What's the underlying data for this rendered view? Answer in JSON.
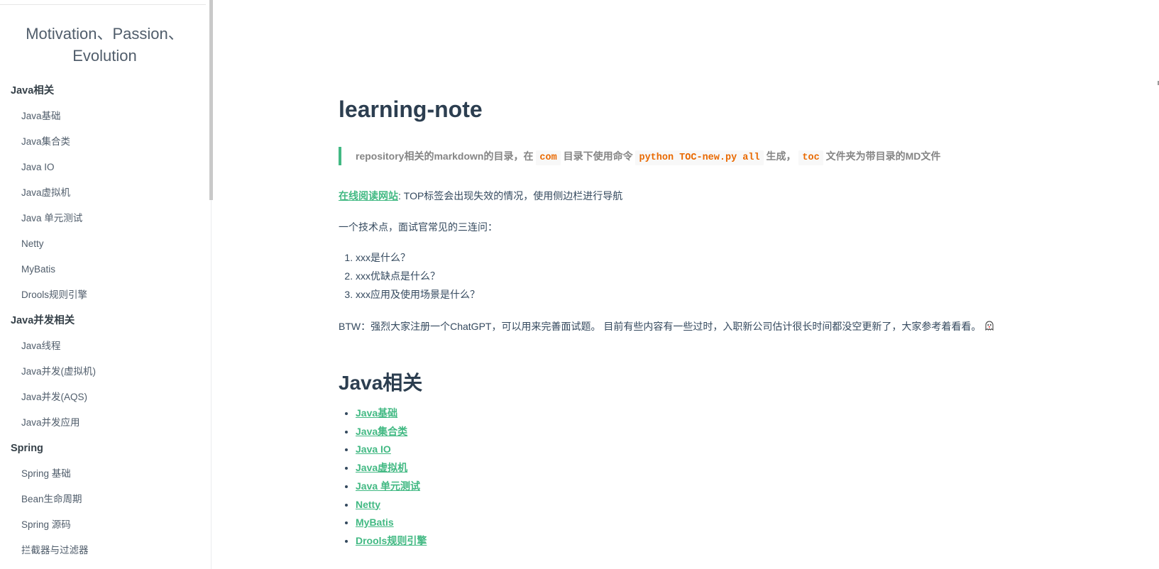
{
  "sidebar": {
    "title": "Motivation、Passion、Evolution",
    "groups": [
      {
        "label": "Java相关",
        "items": [
          "Java基础",
          "Java集合类",
          "Java IO",
          "Java虚拟机",
          "Java 单元测试",
          "Netty",
          "MyBatis",
          "Drools规则引擎"
        ]
      },
      {
        "label": "Java并发相关",
        "items": [
          "Java线程",
          "Java并发(虚拟机)",
          "Java并发(AQS)",
          "Java并发应用"
        ]
      },
      {
        "label": "Spring",
        "items": [
          "Spring 基础",
          "Bean生命周期",
          "Spring 源码",
          "拦截器与过滤器"
        ]
      }
    ]
  },
  "main": {
    "title": "learning-note",
    "blockquote": {
      "t1": "repository相关的markdown的目录，在",
      "code1": "com",
      "t2": "目录下使用命令",
      "code2": "python TOC-new.py all",
      "t3": "生成，",
      "code3": "toc",
      "t4": "文件夹为带目录的MD文件"
    },
    "online_link": "在线阅读网站",
    "online_text": ": TOP标签会出现失效的情况，使用侧边栏进行导航",
    "intro": "一个技术点，面试官常见的三连问：",
    "questions": [
      "xxx是什么？",
      "xxx优缺点是什么？",
      "xxx应用及使用场景是什么？"
    ],
    "btw": "BTW：强烈大家注册一个ChatGPT，可以用来完善面试题。 目前有些内容有一些过时，入职新公司估计很长时间都没空更新了，大家参考着看看。",
    "btw_icon": "ghost-icon",
    "section_title": "Java相关",
    "section_links": [
      "Java基础",
      "Java集合类",
      "Java IO",
      "Java虚拟机",
      "Java 单元测试",
      "Netty",
      "MyBatis",
      "Drools规则引擎"
    ]
  },
  "colors": {
    "accent": "#42b983",
    "code": "#e96900",
    "text": "#34495e"
  }
}
